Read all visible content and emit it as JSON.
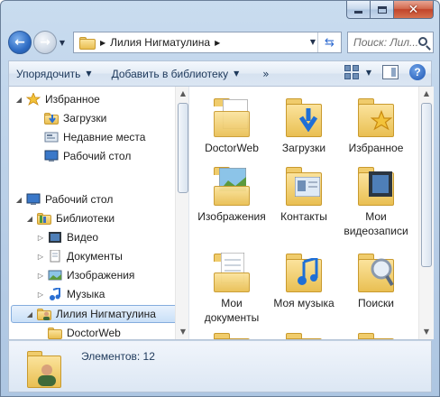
{
  "window": {
    "accent": "#2e6cc4"
  },
  "address": {
    "path": "Лилия Нигматулина",
    "search_placeholder": "Поиск: Лил..."
  },
  "toolbar": {
    "organize": "Упорядочить",
    "add_to_library": "Добавить в библиотеку",
    "more": "»",
    "help": "?"
  },
  "nav": {
    "items": [
      {
        "label": "Избранное",
        "icon": "star-icon"
      },
      {
        "label": "Загрузки",
        "icon": "downloads-folder-icon"
      },
      {
        "label": "Недавние места",
        "icon": "recent-places-icon"
      },
      {
        "label": "Рабочий стол",
        "icon": "desktop-icon"
      },
      {
        "label": "Рабочий стол",
        "icon": "desktop-icon"
      },
      {
        "label": "Библиотеки",
        "icon": "libraries-icon"
      },
      {
        "label": "Видео",
        "icon": "video-icon"
      },
      {
        "label": "Документы",
        "icon": "documents-icon"
      },
      {
        "label": "Изображения",
        "icon": "pictures-icon"
      },
      {
        "label": "Музыка",
        "icon": "music-icon"
      },
      {
        "label": "Лилия Нигматулина",
        "icon": "user-folder-icon"
      },
      {
        "label": "DoctorWeb",
        "icon": "folder-icon"
      }
    ]
  },
  "files": {
    "items": [
      {
        "label": "DoctorWeb",
        "icon": "folder-doc-icon"
      },
      {
        "label": "Загрузки",
        "icon": "downloads-folder-icon"
      },
      {
        "label": "Избранное",
        "icon": "favorites-folder-icon"
      },
      {
        "label": "Изображения",
        "icon": "pictures-folder-icon"
      },
      {
        "label": "Контакты",
        "icon": "contacts-folder-icon"
      },
      {
        "label": "Мои видеозаписи",
        "icon": "videos-folder-icon"
      },
      {
        "label": "Мои документы",
        "icon": "documents-folder-icon"
      },
      {
        "label": "Моя музыка",
        "icon": "music-folder-icon"
      },
      {
        "label": "Поиски",
        "icon": "searches-folder-icon"
      }
    ]
  },
  "status": {
    "count_text": "Элементов: 12"
  }
}
